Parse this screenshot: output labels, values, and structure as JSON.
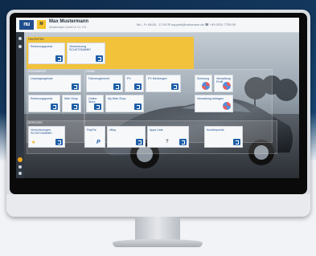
{
  "header": {
    "logo_text": "nu",
    "avatar_text": "M",
    "user_name": "Max Mustermann",
    "user_subtitle": "Mustermann GmbH & Co. KG",
    "contact_line": "Mo - Fr 08:00 - 17:00   ✉ support@nutzmann.de   ☎ +49 0201 7755 00"
  },
  "groups": {
    "favorites": "Favoriten",
    "documents": "Dokumente",
    "company": "Firma",
    "services": "Services"
  },
  "tiles": {
    "rechnungsportal": "Rechnungsportal",
    "versicherung_1": "Versicherung SCHÜTZMANN?",
    "leasingangebote": "Leasingangebote",
    "rechnungsportal_2": "Rechnungsportal",
    "web_shop": "Web Shop",
    "fahrzeugbericht": "Fahrzeugbericht",
    "pv": "PV",
    "pv_meldungen": "PV Meldungen",
    "schulung": "Schulung",
    "verwaltung_profil": "Verwaltung Profil",
    "online_store": "Online Store",
    "my_web_shop": "My Web Shop",
    "verwaltung_anfragen": "Verwaltung Anfragen",
    "versicherung_2": "Versicherungen SCHÜTZMANN?",
    "paypal": "PayPal",
    "ebay": "eBay",
    "apps_liste": "Apps Liste",
    "kundenportal": "Kundenportal"
  },
  "colors": {
    "accent_blue": "#1f5fa8",
    "accent_yellow": "#f2c23a",
    "sidebar": "#2f3742"
  }
}
